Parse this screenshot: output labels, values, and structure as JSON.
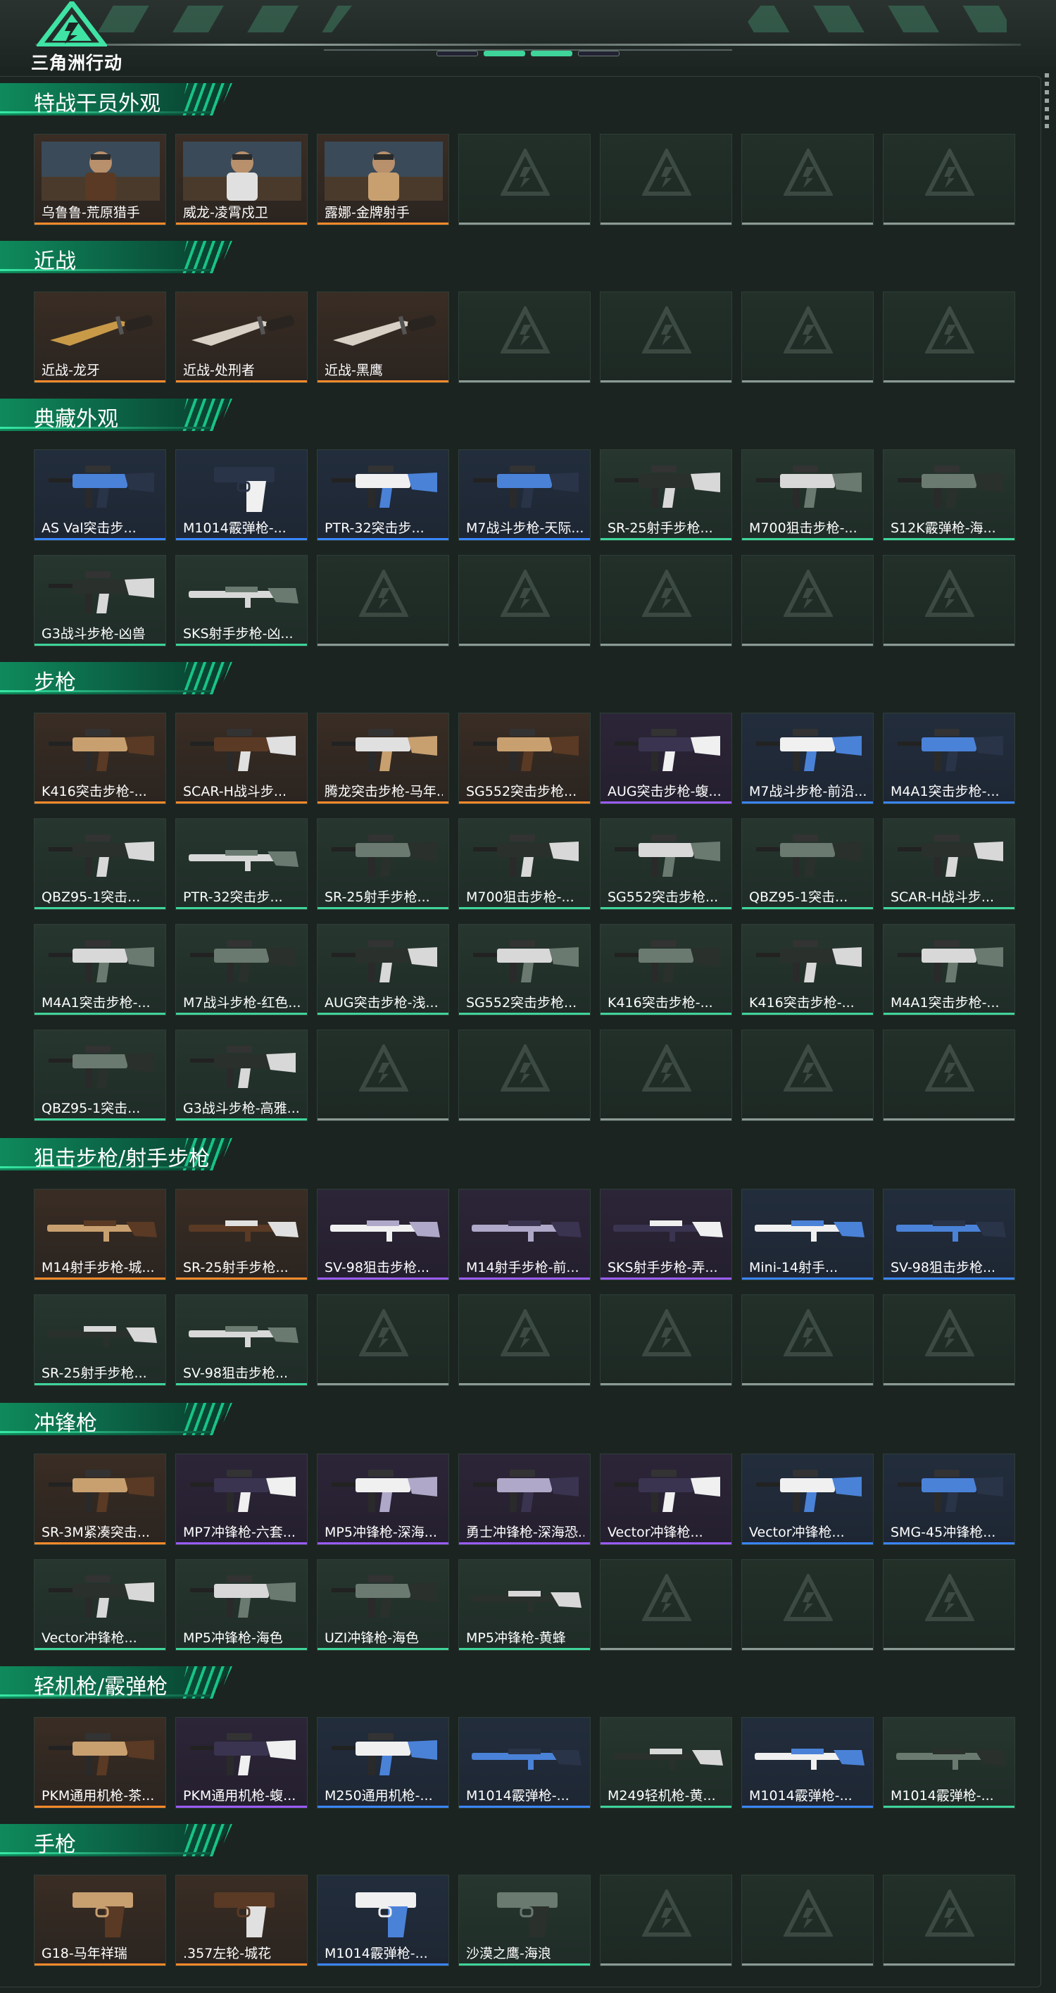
{
  "header": {
    "brand": "三角洲行动"
  },
  "colors": {
    "orange": "#ff8a2a",
    "purple": "#9b5cff",
    "blue": "#3a86ff",
    "green": "#3fd49a",
    "empty": "#8c9a95"
  },
  "sections": [
    {
      "title": "特战干员外观",
      "items": [
        {
          "label": "乌鲁鲁-荒原猎手",
          "rarity": "orange",
          "type": "operator"
        },
        {
          "label": "威龙-凌霄戍卫",
          "rarity": "orange",
          "type": "operator"
        },
        {
          "label": "露娜-金牌射手",
          "rarity": "orange",
          "type": "operator"
        }
      ]
    },
    {
      "title": "近战",
      "items": [
        {
          "label": "近战-龙牙",
          "rarity": "orange",
          "type": "melee"
        },
        {
          "label": "近战-处刑者",
          "rarity": "orange",
          "type": "melee"
        },
        {
          "label": "近战-黑鹰",
          "rarity": "orange",
          "type": "melee"
        }
      ]
    },
    {
      "title": "典藏外观",
      "items": [
        {
          "label": "AS Val突击步...",
          "rarity": "blue",
          "type": "gun"
        },
        {
          "label": "M1014霰弹枪-...",
          "rarity": "blue",
          "type": "pistol"
        },
        {
          "label": "PTR-32突击步...",
          "rarity": "blue",
          "type": "gun"
        },
        {
          "label": "M7战斗步枪-天际...",
          "rarity": "blue",
          "type": "gun"
        },
        {
          "label": "SR-25射手步枪...",
          "rarity": "green",
          "type": "gun"
        },
        {
          "label": "M700狙击步枪-...",
          "rarity": "green",
          "type": "gun"
        },
        {
          "label": "S12K霰弹枪-海...",
          "rarity": "green",
          "type": "gun"
        },
        {
          "label": "G3战斗步枪-凶兽",
          "rarity": "green",
          "type": "gun"
        },
        {
          "label": "SKS射手步枪-凶...",
          "rarity": "green",
          "type": "rifle"
        }
      ]
    },
    {
      "title": "步枪",
      "items": [
        {
          "label": "K416突击步枪-...",
          "rarity": "orange",
          "type": "gun"
        },
        {
          "label": "SCAR-H战斗步...",
          "rarity": "orange",
          "type": "gun"
        },
        {
          "label": "腾龙突击步枪-马年...",
          "rarity": "orange",
          "type": "gun"
        },
        {
          "label": "SG552突击步枪...",
          "rarity": "orange",
          "type": "gun"
        },
        {
          "label": "AUG突击步枪-蝮...",
          "rarity": "purple",
          "type": "gun"
        },
        {
          "label": "M7战斗步枪-前沿...",
          "rarity": "blue",
          "type": "gun"
        },
        {
          "label": "M4A1突击步枪-...",
          "rarity": "blue",
          "type": "gun"
        },
        {
          "label": "QBZ95-1突击...",
          "rarity": "green",
          "type": "gun"
        },
        {
          "label": "PTR-32突击步...",
          "rarity": "green",
          "type": "rifle"
        },
        {
          "label": "SR-25射手步枪...",
          "rarity": "green",
          "type": "gun"
        },
        {
          "label": "M700狙击步枪-...",
          "rarity": "green",
          "type": "gun"
        },
        {
          "label": "SG552突击步枪...",
          "rarity": "green",
          "type": "gun"
        },
        {
          "label": "QBZ95-1突击...",
          "rarity": "green",
          "type": "gun"
        },
        {
          "label": "SCAR-H战斗步...",
          "rarity": "green",
          "type": "gun"
        },
        {
          "label": "M4A1突击步枪-...",
          "rarity": "green",
          "type": "gun"
        },
        {
          "label": "M7战斗步枪-红色...",
          "rarity": "green",
          "type": "gun"
        },
        {
          "label": "AUG突击步枪-浅...",
          "rarity": "green",
          "type": "gun"
        },
        {
          "label": "SG552突击步枪...",
          "rarity": "green",
          "type": "gun"
        },
        {
          "label": "K416突击步枪-...",
          "rarity": "green",
          "type": "gun"
        },
        {
          "label": "K416突击步枪-...",
          "rarity": "green",
          "type": "gun"
        },
        {
          "label": "M4A1突击步枪-...",
          "rarity": "green",
          "type": "gun"
        },
        {
          "label": "QBZ95-1突击...",
          "rarity": "green",
          "type": "gun"
        },
        {
          "label": "G3战斗步枪-高雅...",
          "rarity": "green",
          "type": "gun"
        }
      ]
    },
    {
      "title": "狙击步枪/射手步枪",
      "items": [
        {
          "label": "M14射手步枪-城...",
          "rarity": "orange",
          "type": "rifle"
        },
        {
          "label": "SR-25射手步枪...",
          "rarity": "orange",
          "type": "rifle"
        },
        {
          "label": "SV-98狙击步枪...",
          "rarity": "purple",
          "type": "rifle"
        },
        {
          "label": "M14射手步枪-前...",
          "rarity": "purple",
          "type": "rifle"
        },
        {
          "label": "SKS射手步枪-弄...",
          "rarity": "purple",
          "type": "rifle"
        },
        {
          "label": "Mini-14射手...",
          "rarity": "blue",
          "type": "rifle"
        },
        {
          "label": "SV-98狙击步枪...",
          "rarity": "blue",
          "type": "rifle"
        },
        {
          "label": "SR-25射手步枪...",
          "rarity": "green",
          "type": "rifle"
        },
        {
          "label": "SV-98狙击步枪...",
          "rarity": "green",
          "type": "rifle"
        }
      ]
    },
    {
      "title": "冲锋枪",
      "items": [
        {
          "label": "SR-3M紧凑突击...",
          "rarity": "orange",
          "type": "gun"
        },
        {
          "label": "MP7冲锋枪-六套...",
          "rarity": "purple",
          "type": "gun"
        },
        {
          "label": "MP5冲锋枪-深海...",
          "rarity": "purple",
          "type": "gun"
        },
        {
          "label": "勇士冲锋枪-深海恐...",
          "rarity": "purple",
          "type": "gun"
        },
        {
          "label": "Vector冲锋枪...",
          "rarity": "purple",
          "type": "gun"
        },
        {
          "label": "Vector冲锋枪...",
          "rarity": "blue",
          "type": "gun"
        },
        {
          "label": "SMG-45冲锋枪...",
          "rarity": "blue",
          "type": "gun"
        },
        {
          "label": "Vector冲锋枪...",
          "rarity": "green",
          "type": "gun"
        },
        {
          "label": "MP5冲锋枪-海色",
          "rarity": "green",
          "type": "gun"
        },
        {
          "label": "UZI冲锋枪-海色",
          "rarity": "green",
          "type": "gun"
        },
        {
          "label": "MP5冲锋枪-黄蜂",
          "rarity": "green",
          "type": "rifle"
        }
      ]
    },
    {
      "title": "轻机枪/霰弹枪",
      "items": [
        {
          "label": "PKM通用机枪-茶...",
          "rarity": "orange",
          "type": "gun"
        },
        {
          "label": "PKM通用机枪-蝮...",
          "rarity": "purple",
          "type": "gun"
        },
        {
          "label": "M250通用机枪-...",
          "rarity": "blue",
          "type": "gun"
        },
        {
          "label": "M1014霰弹枪-...",
          "rarity": "blue",
          "type": "rifle"
        },
        {
          "label": "M249轻机枪-黄...",
          "rarity": "green",
          "type": "rifle"
        },
        {
          "label": "M1014霰弹枪-...",
          "rarity": "blue",
          "type": "rifle"
        },
        {
          "label": "M1014霰弹枪-...",
          "rarity": "green",
          "type": "rifle"
        }
      ]
    },
    {
      "title": "手枪",
      "items": [
        {
          "label": "G18-马年祥瑞",
          "rarity": "orange",
          "type": "pistol"
        },
        {
          "label": ".357左轮-城花",
          "rarity": "orange",
          "type": "pistol"
        },
        {
          "label": "M1014霰弹枪-...",
          "rarity": "blue",
          "type": "pistol"
        },
        {
          "label": "沙漠之鹰-海浪",
          "rarity": "green",
          "type": "pistol"
        }
      ]
    }
  ]
}
